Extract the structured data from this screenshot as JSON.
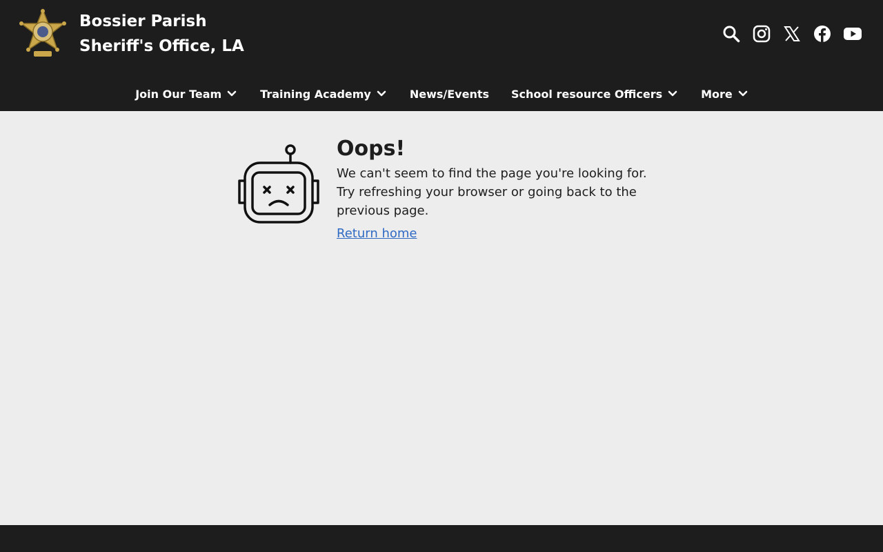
{
  "header": {
    "title_line1": "Bossier Parish",
    "title_line2": "Sheriff's Office, LA",
    "social_icons": [
      "search-icon",
      "instagram-icon",
      "x-icon",
      "facebook-icon",
      "youtube-icon"
    ]
  },
  "nav": {
    "items": [
      {
        "label": "Join Our Team",
        "has_dropdown": true
      },
      {
        "label": "Training Academy",
        "has_dropdown": true
      },
      {
        "label": "News/Events",
        "has_dropdown": false
      },
      {
        "label": "School resource Officers",
        "has_dropdown": true
      },
      {
        "label": "More",
        "has_dropdown": true
      }
    ]
  },
  "error": {
    "title": "Oops!",
    "message": "We can't seem to find the page you're looking for. Try refreshing your browser or going back to the previous page.",
    "link_label": "Return home"
  },
  "colors": {
    "header_bg": "#1d1d1d",
    "body_bg": "#ededed",
    "link": "#2e6ac3",
    "text": "#1d1d1d"
  }
}
